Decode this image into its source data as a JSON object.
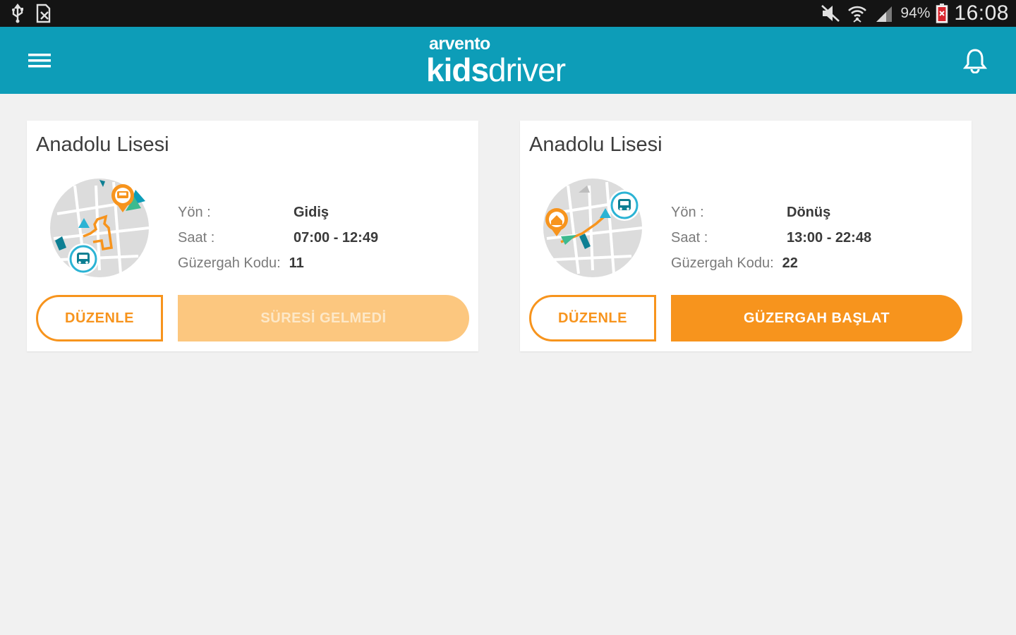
{
  "status_bar": {
    "left_icons": [
      "usb-icon",
      "sd-card-icon"
    ],
    "right_icons": [
      "mute-icon",
      "wifi-icon",
      "cell-signal-icon",
      "battery-icon"
    ],
    "battery_percent": "94%",
    "time": "16:08"
  },
  "app_bar": {
    "logo_top": "arvento",
    "logo_kids": "kids",
    "logo_driver": "driver",
    "menu_icon": "hamburger-menu-icon",
    "bell_icon": "bell-icon"
  },
  "colors": {
    "app_bar": "#0d9db8",
    "accent_orange": "#f7941d",
    "disabled_orange": "#fcc77f",
    "background": "#f1f1f1"
  },
  "routes": [
    {
      "school": "Anadolu Lisesi",
      "direction_label": "Yön :",
      "direction": "Gidiş",
      "time_label": "Saat :",
      "time": "07:00 - 12:49",
      "code_label": "Güzergah Kodu:",
      "code": "11",
      "edit_label": "DÜZENLE",
      "action_label": "SÜRESİ GELMEDİ",
      "action_enabled": false,
      "map_icon": "route-outbound-map-icon"
    },
    {
      "school": "Anadolu Lisesi",
      "direction_label": "Yön :",
      "direction": "Dönüş",
      "time_label": "Saat :",
      "time": "13:00 - 22:48",
      "code_label": "Güzergah Kodu:",
      "code": "22",
      "edit_label": "DÜZENLE",
      "action_label": "GÜZERGAH BAŞLAT",
      "action_enabled": true,
      "map_icon": "route-return-map-icon"
    }
  ]
}
